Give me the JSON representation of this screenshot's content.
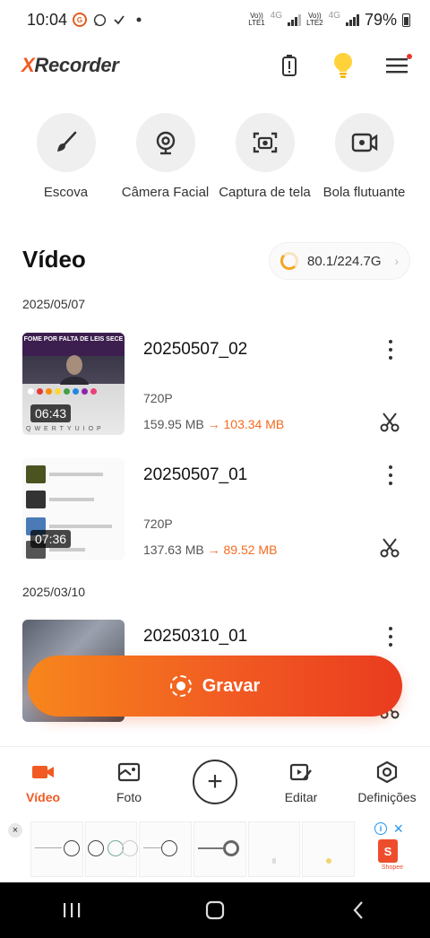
{
  "status_bar": {
    "time": "10:04",
    "volte1": "Vo)) LTE1",
    "volte2": "Vo)) LTE2",
    "net1": "4G",
    "net2": "4G",
    "battery": "79%"
  },
  "header": {
    "app_name_x": "X",
    "app_name_rest": "Recorder"
  },
  "tools": [
    {
      "label": "Escova",
      "icon": "brush-icon"
    },
    {
      "label": "Câmera Facial",
      "icon": "webcam-icon"
    },
    {
      "label": "Captura de tela",
      "icon": "screenshot-icon"
    },
    {
      "label": "Bola flutuante",
      "icon": "floating-ball-icon"
    }
  ],
  "section": {
    "title": "Vídeo",
    "storage": "80.1/224.7G"
  },
  "groups": [
    {
      "date": "2025/05/07",
      "items": [
        {
          "name": "20250507_02",
          "duration": "06:43",
          "resolution": "720P",
          "size_original": "159.95 MB",
          "arrow": "→",
          "size_compressed": "103.34 MB"
        },
        {
          "name": "20250507_01",
          "duration": "07:36",
          "resolution": "720P",
          "size_original": "137.63 MB",
          "arrow": "→",
          "size_compressed": "89.52 MB"
        }
      ]
    },
    {
      "date": "2025/03/10",
      "items": [
        {
          "name": "20250310_01"
        }
      ]
    }
  ],
  "thumb1": {
    "banner": "FOME POR FALTA DE LEIS SECE",
    "keys": "QWERTYUIOP"
  },
  "record_button": {
    "label": "Gravar"
  },
  "bottom_nav": [
    {
      "label": "Vídeo",
      "active": true
    },
    {
      "label": "Foto"
    },
    {
      "label": "+"
    },
    {
      "label": "Editar"
    },
    {
      "label": "Definições"
    }
  ],
  "ad": {
    "close": "×",
    "info": "i",
    "dismiss": "×",
    "brand_letter": "S",
    "brand": "Shopee"
  },
  "colors": {
    "accent": "#f15a22",
    "accent_light": "#f7861c"
  }
}
